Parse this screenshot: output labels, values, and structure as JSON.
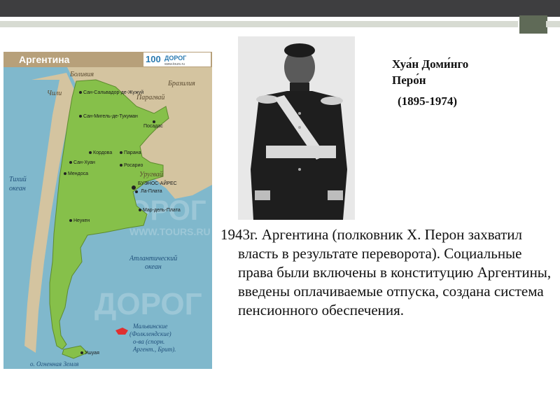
{
  "map": {
    "title": "Аргентина",
    "logo_text": "ДОРОГ",
    "logo_number": "100",
    "logo_url": "www.tours.ru",
    "watermark": "ДОРОГ",
    "watermark_url": "WWW.TOURS.RU",
    "countries": {
      "bolivia": "Боливия",
      "chile": "Чили",
      "paraguay": "Парагвай",
      "brazil": "Бразилия",
      "uruguay": "Уругвай"
    },
    "oceans": {
      "pacific_1": "Тихий",
      "pacific_2": "океан",
      "atlantic_1": "Атлантический",
      "atlantic_2": "океан"
    },
    "cities": [
      "Сан-Сальвадор-де-Жужуй",
      "Сан-Мигель-де-Тукуман",
      "Посадас",
      "Кордова",
      "Парана",
      "Сан-Хуан",
      "Росарио",
      "Мендоса",
      "БУЭНОС-АЙРЕС",
      "Ла-Плата",
      "Мар-дель-Плата",
      "Неукен",
      "Ушуая"
    ],
    "falklands": [
      "Мальвинские",
      "(Фолклендские)",
      "о-ва (спорн.",
      "Аргент., Брит)."
    ],
    "tierra_del_fuego": "о. Огненная Земля",
    "colors": {
      "sea": "#80b8cc",
      "argentina": "#86c04a",
      "neighbors": "#d4c4a0",
      "title_bar": "#b7a07a"
    }
  },
  "photo": {
    "description_icon": "portrait-photo"
  },
  "person": {
    "name_line1": "Хуа́н Доми́нго",
    "name_line2": "Перо́н",
    "years": "(1895-1974)"
  },
  "main_text": "1943г. Аргентина (полковник Х. Перон захватил власть в результате переворота). Социальные права были включены в конституцию Аргентины, введены оплачиваемые отпуска, создана система пенсионного обеспечения."
}
